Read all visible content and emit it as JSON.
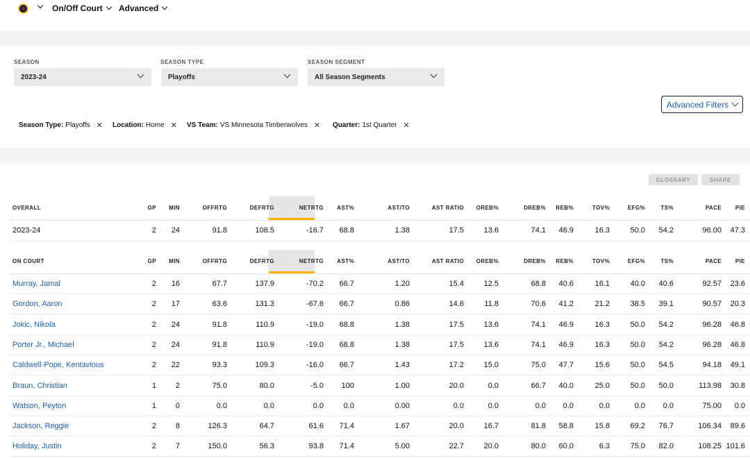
{
  "nav": {
    "items": [
      {
        "label": "On/Off Court"
      },
      {
        "label": "Advanced"
      }
    ]
  },
  "filters": {
    "season": {
      "label": "SEASON",
      "value": "2023-24"
    },
    "season_type": {
      "label": "SEASON TYPE",
      "value": "Playoffs"
    },
    "season_segment": {
      "label": "SEASON SEGMENT",
      "value": "All Season Segments"
    },
    "advanced_filters_label": "Advanced Filters"
  },
  "active_filters": [
    {
      "key": "Season Type:",
      "value": "Playoffs"
    },
    {
      "key": "Location:",
      "value": "Home"
    },
    {
      "key": "VS Team:",
      "value": "VS Minnesota Timberwolves"
    },
    {
      "key": "Quarter:",
      "value": "1st Quarter"
    }
  ],
  "actions": {
    "glossary": "GLOSSARY",
    "share": "SHARE"
  },
  "overall": {
    "headers": [
      "OVERALL",
      "GP",
      "MIN",
      "OFFRTG",
      "DEFRTG",
      "NETRTG",
      "AST%",
      "AST/TO",
      "AST RATIO",
      "OREB%",
      "DREB%",
      "REB%",
      "TOV%",
      "EFG%",
      "TS%",
      "PACE",
      "PIE"
    ],
    "rows": [
      [
        "2023-24",
        "2",
        "24",
        "91.8",
        "108.5",
        "-16.7",
        "68.8",
        "1.38",
        "17.5",
        "13.6",
        "74.1",
        "46.9",
        "16.3",
        "50.0",
        "54.2",
        "96.00",
        "47.3"
      ]
    ]
  },
  "on_court": {
    "headers": [
      "ON COURT",
      "GP",
      "MIN",
      "OFFRTG",
      "DEFRTG",
      "NETRTG",
      "AST%",
      "AST/TO",
      "AST RATIO",
      "OREB%",
      "DREB%",
      "REB%",
      "TOV%",
      "EFG%",
      "TS%",
      "PACE",
      "PIE"
    ],
    "rows": [
      [
        "Murray, Jamal",
        "2",
        "16",
        "67.7",
        "137.9",
        "-70.2",
        "66.7",
        "1.20",
        "15.4",
        "12.5",
        "68.8",
        "40.6",
        "16.1",
        "40.0",
        "40.6",
        "92.57",
        "23.6"
      ],
      [
        "Gordon, Aaron",
        "2",
        "17",
        "63.6",
        "131.3",
        "-67.6",
        "66.7",
        "0.86",
        "14.6",
        "11.8",
        "70.6",
        "41.2",
        "21.2",
        "38.5",
        "39.1",
        "90.57",
        "20.3"
      ],
      [
        "Jokic, Nikola",
        "2",
        "24",
        "91.8",
        "110.9",
        "-19.0",
        "68.8",
        "1.38",
        "17.5",
        "13.6",
        "74.1",
        "46.9",
        "16.3",
        "50.0",
        "54.2",
        "96.28",
        "46.8"
      ],
      [
        "Porter Jr., Michael",
        "2",
        "24",
        "91.8",
        "110.9",
        "-19.0",
        "68.8",
        "1.38",
        "17.5",
        "13.6",
        "74.1",
        "46.9",
        "16.3",
        "50.0",
        "54.2",
        "96.28",
        "46.8"
      ],
      [
        "Caldwell-Pope, Kentavious",
        "2",
        "22",
        "93.3",
        "109.3",
        "-16.0",
        "66.7",
        "1.43",
        "17.2",
        "15.0",
        "75.0",
        "47.7",
        "15.6",
        "50.0",
        "54.5",
        "94.18",
        "49.1"
      ],
      [
        "Braun, Christian",
        "1",
        "2",
        "75.0",
        "80.0",
        "-5.0",
        "100",
        "1.00",
        "20.0",
        "0.0",
        "66.7",
        "40.0",
        "25.0",
        "50.0",
        "50.0",
        "113.98",
        "30.8"
      ],
      [
        "Watson, Peyton",
        "1",
        "0",
        "0.0",
        "0.0",
        "0.0",
        "0.0",
        "0.00",
        "0.0",
        "0.0",
        "0.0",
        "0.0",
        "0.0",
        "0.0",
        "0.0",
        "75.00",
        "0.0"
      ],
      [
        "Jackson, Reggie",
        "2",
        "8",
        "126.3",
        "64.7",
        "61.6",
        "71.4",
        "1.67",
        "20.0",
        "16.7",
        "81.8",
        "58.8",
        "15.8",
        "69.2",
        "76.7",
        "106.34",
        "89.6"
      ],
      [
        "Holiday, Justin",
        "2",
        "7",
        "150.0",
        "56.3",
        "93.8",
        "71.4",
        "5.00",
        "22.7",
        "20.0",
        "80.0",
        "60.0",
        "6.3",
        "75.0",
        "82.0",
        "108.25",
        "101.6"
      ]
    ]
  }
}
